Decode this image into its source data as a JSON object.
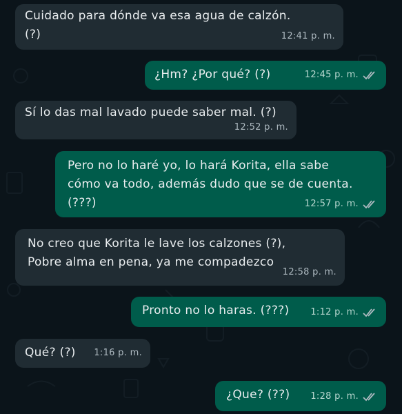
{
  "colors": {
    "background": "#0b141a",
    "incoming_bubble": "#202c33",
    "outgoing_bubble": "#005c4b",
    "text": "#e9edef",
    "timestamp": "#aebac1",
    "read_ticks": "#aebac1"
  },
  "messages": [
    {
      "direction": "incoming",
      "text": "Cuidado para dónde va esa agua de calzón.\n(?)",
      "time": "12:41 p. m.",
      "status": ""
    },
    {
      "direction": "outgoing",
      "text": "¿Hm? ¿Por qué? (?)",
      "time": "12:45 p. m.",
      "status": "read-double-check-icon"
    },
    {
      "direction": "incoming",
      "text": "Sí lo das mal lavado puede saber mal. (?)",
      "time": "12:52 p. m.",
      "status": ""
    },
    {
      "direction": "outgoing",
      "text": "Pero no lo haré yo, lo hará Korita, ella sabe\ncómo va todo, además dudo que se de cuenta.\n(???)",
      "time": "12:57 p. m.",
      "status": "read-double-check-icon"
    },
    {
      "direction": "incoming",
      "text": "No creo que Korita le lave los calzones (?),\nPobre alma en pena, ya me compadezco",
      "time": "12:58 p. m.",
      "status": ""
    },
    {
      "direction": "outgoing",
      "text": "Pronto no lo haras. (???)",
      "time": "1:12 p. m.",
      "status": "read-double-check-icon"
    },
    {
      "direction": "incoming",
      "text": "Qué? (?)",
      "time": "1:16 p. m.",
      "status": ""
    },
    {
      "direction": "outgoing",
      "text": "¿Que? (??)",
      "time": "1:28 p. m.",
      "status": "read-double-check-icon"
    }
  ]
}
